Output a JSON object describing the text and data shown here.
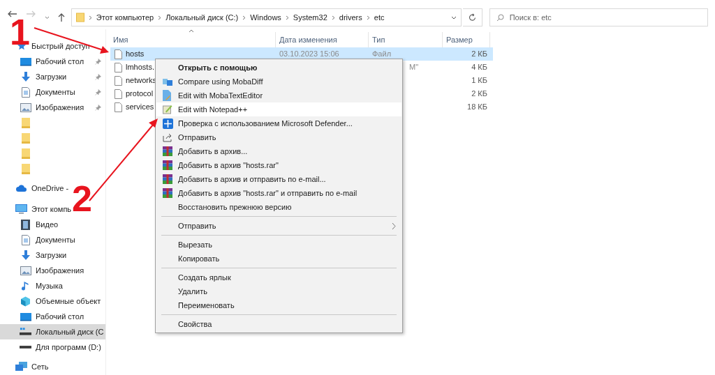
{
  "navigation": {
    "back_enabled": true,
    "forward_enabled": false
  },
  "address_bar": {
    "segments": [
      "Этот компьютер",
      "Локальный диск (C:)",
      "Windows",
      "System32",
      "drivers",
      "etc"
    ]
  },
  "search": {
    "placeholder": "Поиск в: etc"
  },
  "sidebar": {
    "items": [
      {
        "kind": "heading",
        "label": "Быстрый доступ",
        "pinned": false,
        "selected": false
      },
      {
        "kind": "item",
        "label": "Рабочий стол",
        "pinned": true,
        "selected": false
      },
      {
        "kind": "item",
        "label": "Загрузки",
        "pinned": true,
        "selected": false
      },
      {
        "kind": "item",
        "label": "Документы",
        "pinned": true,
        "selected": false
      },
      {
        "kind": "item",
        "label": "Изображения",
        "pinned": true,
        "selected": false
      },
      {
        "kind": "item",
        "pinned": false,
        "selected": false
      },
      {
        "kind": "item",
        "pinned": false,
        "selected": false
      },
      {
        "kind": "item",
        "pinned": false,
        "selected": false
      },
      {
        "kind": "item",
        "pinned": false,
        "selected": false
      },
      {
        "kind": "heading",
        "label": "OneDrive -",
        "pinned": false,
        "selected": false
      },
      {
        "kind": "heading",
        "label": "Этот компь",
        "pinned": false,
        "selected": false
      },
      {
        "kind": "item",
        "label": "Видео",
        "pinned": false,
        "selected": false
      },
      {
        "kind": "item",
        "label": "Документы",
        "pinned": false,
        "selected": false
      },
      {
        "kind": "item",
        "label": "Загрузки",
        "pinned": false,
        "selected": false
      },
      {
        "kind": "item",
        "label": "Изображения",
        "pinned": false,
        "selected": false
      },
      {
        "kind": "item",
        "label": "Музыка",
        "pinned": false,
        "selected": false
      },
      {
        "kind": "item",
        "label": "Объемные объект",
        "pinned": false,
        "selected": false
      },
      {
        "kind": "item",
        "label": "Рабочий стол",
        "pinned": false,
        "selected": false
      },
      {
        "kind": "item",
        "label": "Локальный диск (C",
        "pinned": false,
        "selected": true
      },
      {
        "kind": "item",
        "label": "Для программ (D:)",
        "pinned": false,
        "selected": false
      },
      {
        "kind": "heading",
        "label": "Сеть",
        "pinned": false,
        "selected": false
      }
    ]
  },
  "file_list": {
    "columns": [
      "Имя",
      "Дата изменения",
      "Тип",
      "Размер"
    ],
    "rows": [
      {
        "name": "hosts",
        "date": "03.10.2023 15:06",
        "type": "Файл",
        "size": "2 КБ",
        "selected": true
      },
      {
        "name": "lmhosts.",
        "type": "M\"",
        "size": "4 КБ",
        "selected": false
      },
      {
        "name": "networks",
        "size": "1 КБ",
        "selected": false
      },
      {
        "name": "protocol",
        "size": "2 КБ",
        "selected": false
      },
      {
        "name": "services",
        "size": "18 КБ",
        "selected": false
      }
    ]
  },
  "context_menu": {
    "items": [
      {
        "kind": "item",
        "label": "Открыть с помощью",
        "default": true,
        "selected": false
      },
      {
        "kind": "item",
        "label": "Compare using MobaDiff",
        "default": false,
        "selected": false
      },
      {
        "kind": "item",
        "label": "Edit with MobaTextEditor",
        "default": false,
        "selected": false
      },
      {
        "kind": "item",
        "label": "Edit with Notepad++",
        "default": false,
        "selected": true
      },
      {
        "kind": "item",
        "label": "Проверка с использованием Microsoft Defender...",
        "default": false,
        "selected": false
      },
      {
        "kind": "item",
        "label": "Отправить",
        "default": false,
        "selected": false
      },
      {
        "kind": "item",
        "label": "Добавить в архив...",
        "default": false,
        "selected": false
      },
      {
        "kind": "item",
        "label": "Добавить в архив \"hosts.rar\"",
        "default": false,
        "selected": false
      },
      {
        "kind": "item",
        "label": "Добавить в архив и отправить по e-mail...",
        "default": false,
        "selected": false
      },
      {
        "kind": "item",
        "label": "Добавить в архив \"hosts.rar\" и отправить по e-mail",
        "default": false,
        "selected": false
      },
      {
        "kind": "item",
        "label": "Восстановить прежнюю версию",
        "default": false,
        "selected": false
      },
      {
        "kind": "separator"
      },
      {
        "kind": "submenu",
        "label": "Отправить",
        "default": false,
        "selected": false
      },
      {
        "kind": "separator"
      },
      {
        "kind": "item",
        "label": "Вырезать",
        "default": false,
        "selected": false
      },
      {
        "kind": "item",
        "label": "Копировать",
        "default": false,
        "selected": false
      },
      {
        "kind": "separator"
      },
      {
        "kind": "item",
        "label": "Создать ярлык",
        "default": false,
        "selected": false
      },
      {
        "kind": "item",
        "label": "Удалить",
        "default": false,
        "selected": false
      },
      {
        "kind": "item",
        "label": "Переименовать",
        "default": false,
        "selected": false
      },
      {
        "kind": "separator"
      },
      {
        "kind": "item",
        "label": "Свойства",
        "default": false,
        "selected": false
      }
    ]
  },
  "annotations": [
    {
      "label": "1"
    },
    {
      "label": "2"
    }
  ]
}
